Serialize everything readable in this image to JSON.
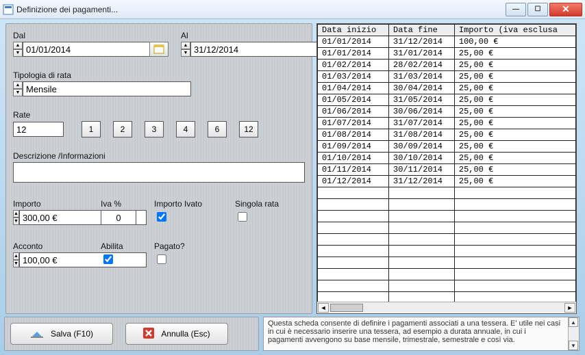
{
  "window": {
    "title": "Definizione dei pagamenti..."
  },
  "labels": {
    "dal": "Dal",
    "al": "Al",
    "tipologia": "Tipologia di rata",
    "rate": "Rate",
    "descrizione": "Descrizione /Informazioni",
    "importo": "Importo",
    "iva": "Iva %",
    "importo_ivato": "Importo Ivato",
    "singola_rata": "Singola rata",
    "acconto": "Acconto",
    "abilita": "Abilita",
    "pagato": "Pagato?"
  },
  "values": {
    "dal": "01/01/2014",
    "al": "31/12/2014",
    "tipologia": "Mensile",
    "rate": "12",
    "descrizione": "",
    "importo": "300,00 €",
    "iva": "0",
    "importo_ivato_checked": true,
    "singola_rata_checked": false,
    "acconto": "100,00 €",
    "abilita_checked": true,
    "pagato_checked": false
  },
  "rate_buttons": [
    "1",
    "2",
    "3",
    "4",
    "6",
    "12"
  ],
  "table": {
    "headers": [
      "Data inizio",
      "Data fine",
      "Importo (iva esclusa"
    ],
    "rows": [
      [
        "01/01/2014",
        "31/12/2014",
        "100,00 €"
      ],
      [
        "01/01/2014",
        "31/01/2014",
        "25,00 €"
      ],
      [
        "01/02/2014",
        "28/02/2014",
        "25,00 €"
      ],
      [
        "01/03/2014",
        "31/03/2014",
        "25,00 €"
      ],
      [
        "01/04/2014",
        "30/04/2014",
        "25,00 €"
      ],
      [
        "01/05/2014",
        "31/05/2014",
        "25,00 €"
      ],
      [
        "01/06/2014",
        "30/06/2014",
        "25,00 €"
      ],
      [
        "01/07/2014",
        "31/07/2014",
        "25,00 €"
      ],
      [
        "01/08/2014",
        "31/08/2014",
        "25,00 €"
      ],
      [
        "01/09/2014",
        "30/09/2014",
        "25,00 €"
      ],
      [
        "01/10/2014",
        "30/10/2014",
        "25,00 €"
      ],
      [
        "01/11/2014",
        "30/11/2014",
        "25,00 €"
      ],
      [
        "01/12/2014",
        "31/12/2014",
        "25,00 €"
      ]
    ],
    "empty_rows": 10
  },
  "buttons": {
    "salva": "Salva  (F10)",
    "annulla": "Annulla  (Esc)"
  },
  "help_text": "Questa scheda consente di definire i pagamenti associati a una tessera. E' utile nei casi in cui è necessario inserire una tessera, ad esempio a durata annuale, in cui i pagamenti avvengono su base mensile, trimestrale, semestrale e così via."
}
